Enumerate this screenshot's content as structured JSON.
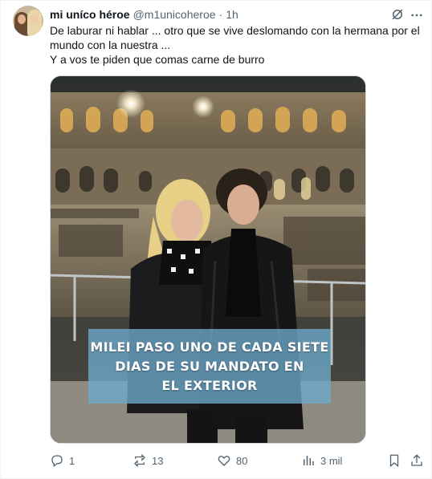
{
  "tweet": {
    "author_name": "mi uníco héroe",
    "handle": "@m1unicoheroe",
    "separator": "·",
    "time": "1h",
    "text_lines": [
      "De laburar ni hablar ... otro que se vive deslomando con la hermana por el mundo con la nuestra ...",
      "Y a vos te piden que comas carne de burro"
    ],
    "media": {
      "caption_lines": [
        "MILEI PASO UNO DE CADA SIETE",
        "DIAS DE SU MANDATO EN",
        "EL EXTERIOR"
      ]
    },
    "actions": {
      "replies": "1",
      "reposts": "13",
      "likes": "80",
      "views": "3 mil"
    }
  },
  "icons": {
    "grok": "grok-icon",
    "more": "more-icon",
    "reply": "reply-icon",
    "repost": "repost-icon",
    "like": "heart-icon",
    "views": "views-icon",
    "bookmark": "bookmark-icon",
    "share": "share-icon"
  },
  "colors": {
    "text": "#0f1419",
    "secondary": "#536471",
    "border": "#cfd9de",
    "caption_band": "#6eaacd"
  }
}
